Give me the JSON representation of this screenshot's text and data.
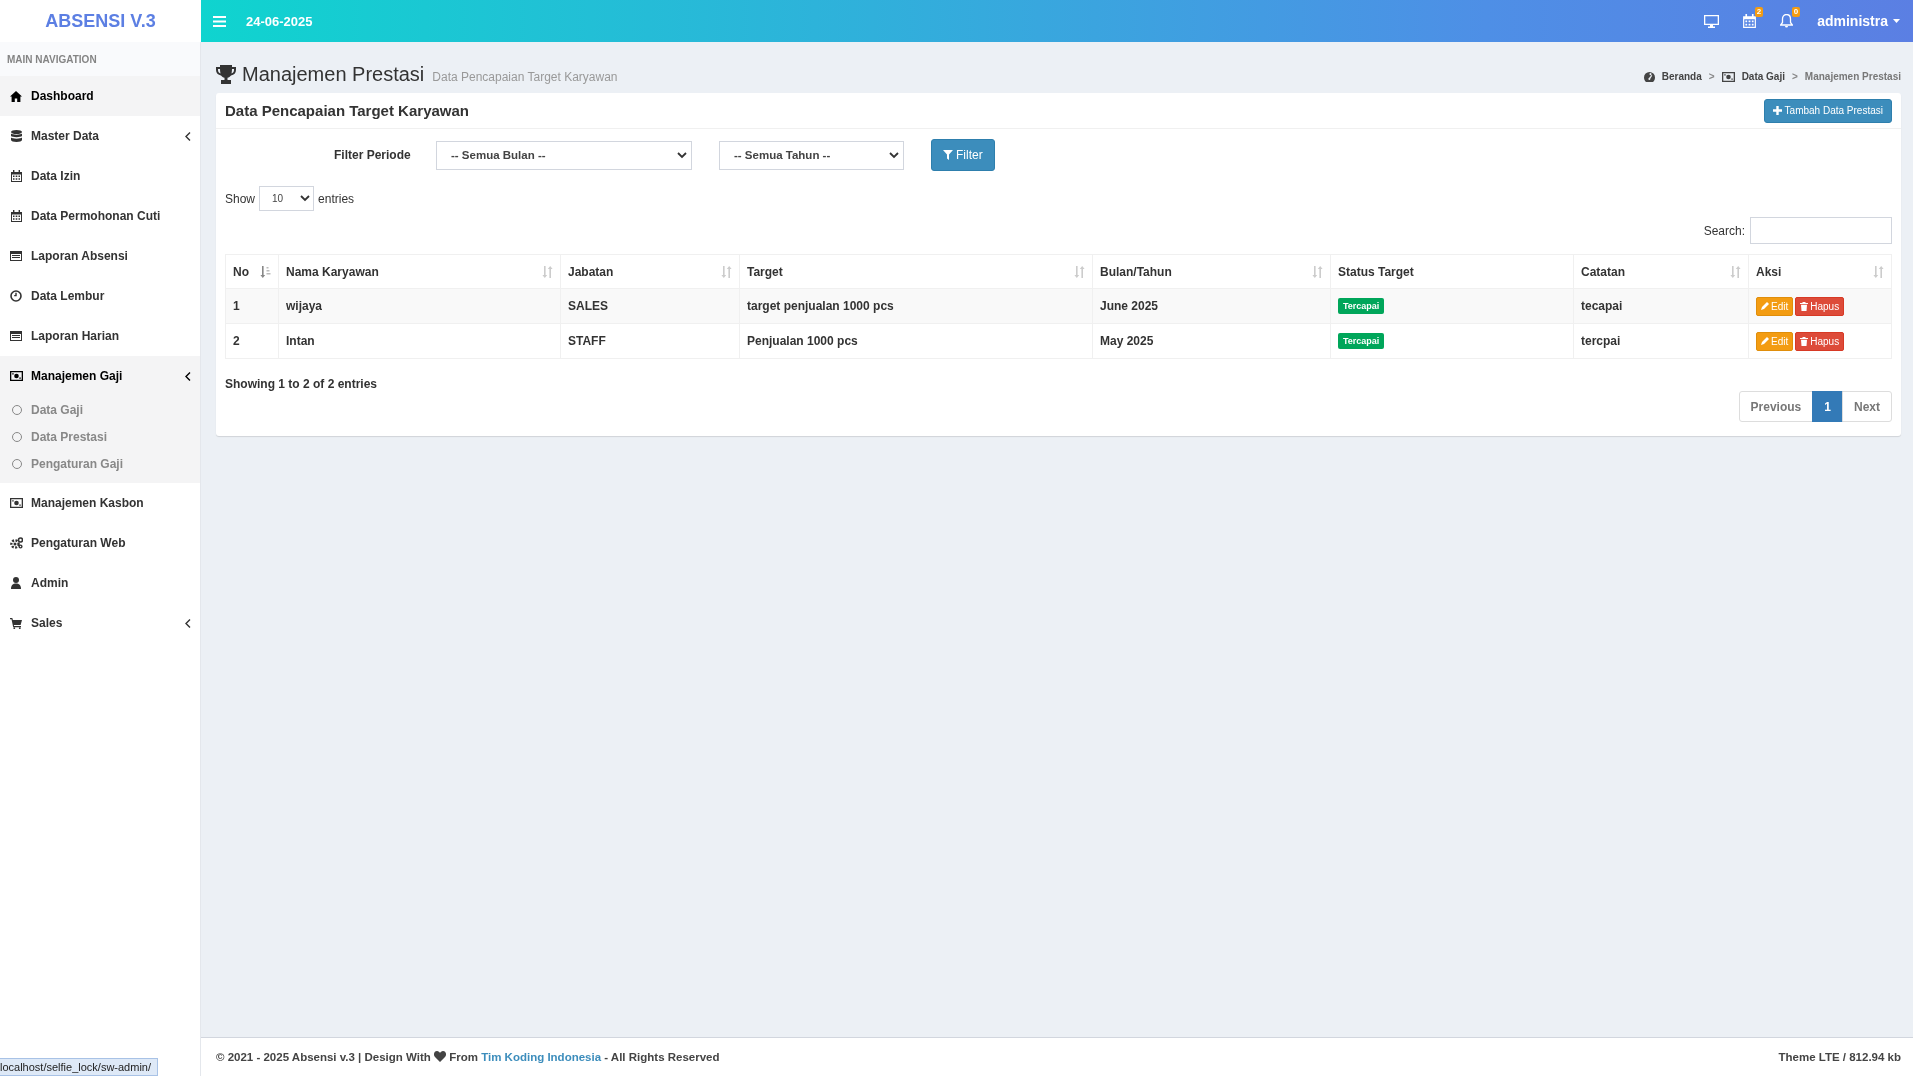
{
  "brand": "ABSENSI V.3",
  "topbar": {
    "date": "24-06-2025",
    "calendar_badge": "2",
    "bell_badge": "0",
    "user": "administra"
  },
  "sidebar": {
    "header": "MAIN NAVIGATION",
    "items": [
      {
        "label": "Dashboard",
        "kind": "link",
        "selected": true
      },
      {
        "label": "Master Data",
        "kind": "menu",
        "selected": false
      },
      {
        "label": "Data Izin",
        "kind": "link",
        "selected": false
      },
      {
        "label": "Data Permohonan Cuti",
        "kind": "link",
        "selected": false
      },
      {
        "label": "Laporan Absensi",
        "kind": "link",
        "selected": false
      },
      {
        "label": "Data Lembur",
        "kind": "link",
        "selected": false
      },
      {
        "label": "Laporan Harian",
        "kind": "link",
        "selected": false
      },
      {
        "label": "Manajemen Gaji",
        "kind": "menu",
        "selected": true,
        "expanded": true,
        "children": [
          {
            "label": "Data Gaji",
            "selected": false
          },
          {
            "label": "Data Prestasi",
            "selected": false
          },
          {
            "label": "Pengaturan Gaji",
            "selected": false
          }
        ]
      },
      {
        "label": "Manajemen Kasbon",
        "kind": "link",
        "selected": false
      },
      {
        "label": "Pengaturan Web",
        "kind": "link",
        "selected": false
      },
      {
        "label": "Admin",
        "kind": "link",
        "selected": false
      },
      {
        "label": "Sales",
        "kind": "menu",
        "selected": false
      }
    ]
  },
  "page": {
    "title": "Manajemen Prestasi",
    "subtitle": "Data Pencapaian Target Karyawan",
    "breadcrumbs": [
      "Beranda",
      "Data Gaji",
      "Manajemen Prestasi"
    ],
    "breadcrumb_separators": [
      ">",
      ">"
    ]
  },
  "box": {
    "title": "Data Pencapaian Target Karyawan",
    "add_button": "Tambah Data Prestasi",
    "filter": {
      "label": "Filter Periode",
      "month": "-- Semua Bulan --",
      "year": "-- Semua Tahun --",
      "button": "Filter"
    },
    "length": {
      "show": "Show",
      "value": "10",
      "entries": "entries"
    },
    "search_label": "Search:",
    "table": {
      "columns": [
        {
          "label": "No",
          "sortable": true,
          "sorted": true
        },
        {
          "label": "Nama Karyawan",
          "sortable": true,
          "sorted": false
        },
        {
          "label": "Jabatan",
          "sortable": true,
          "sorted": false
        },
        {
          "label": "Target",
          "sortable": true,
          "sorted": false
        },
        {
          "label": "Bulan/Tahun",
          "sortable": true,
          "sorted": false
        },
        {
          "label": "Status Target",
          "sortable": false,
          "sorted": false
        },
        {
          "label": "Catatan",
          "sortable": true,
          "sorted": false
        },
        {
          "label": "Aksi",
          "sortable": true,
          "sorted": false
        }
      ],
      "rows": [
        {
          "no": "1",
          "name": "wijaya",
          "position": "SALES",
          "target": "target penjualan 1000 pcs",
          "period": "June 2025",
          "status": "Tercapai",
          "note": "tecapai",
          "edit": "Edit",
          "delete": "Hapus"
        },
        {
          "no": "2",
          "name": "Intan",
          "position": "STAFF",
          "target": "Penjualan 1000 pcs",
          "period": "May 2025",
          "status": "Tercapai",
          "note": "tercpai",
          "edit": "Edit",
          "delete": "Hapus"
        }
      ]
    },
    "info": "Showing 1 to 2 of 2 entries",
    "pagination": [
      {
        "label": "Previous",
        "selected": false
      },
      {
        "label": "1",
        "selected": true
      },
      {
        "label": "Next",
        "selected": false
      }
    ]
  },
  "footer": {
    "before": "© 2021 - 2025 Absensi v.3 | Design With",
    "from": "From",
    "link": "Tim Koding Indonesia",
    "after": "- All Rights Reserved",
    "right": "Theme LTE / 812.94 kb"
  },
  "status_url": "localhost/selfie_lock/sw-admin/"
}
